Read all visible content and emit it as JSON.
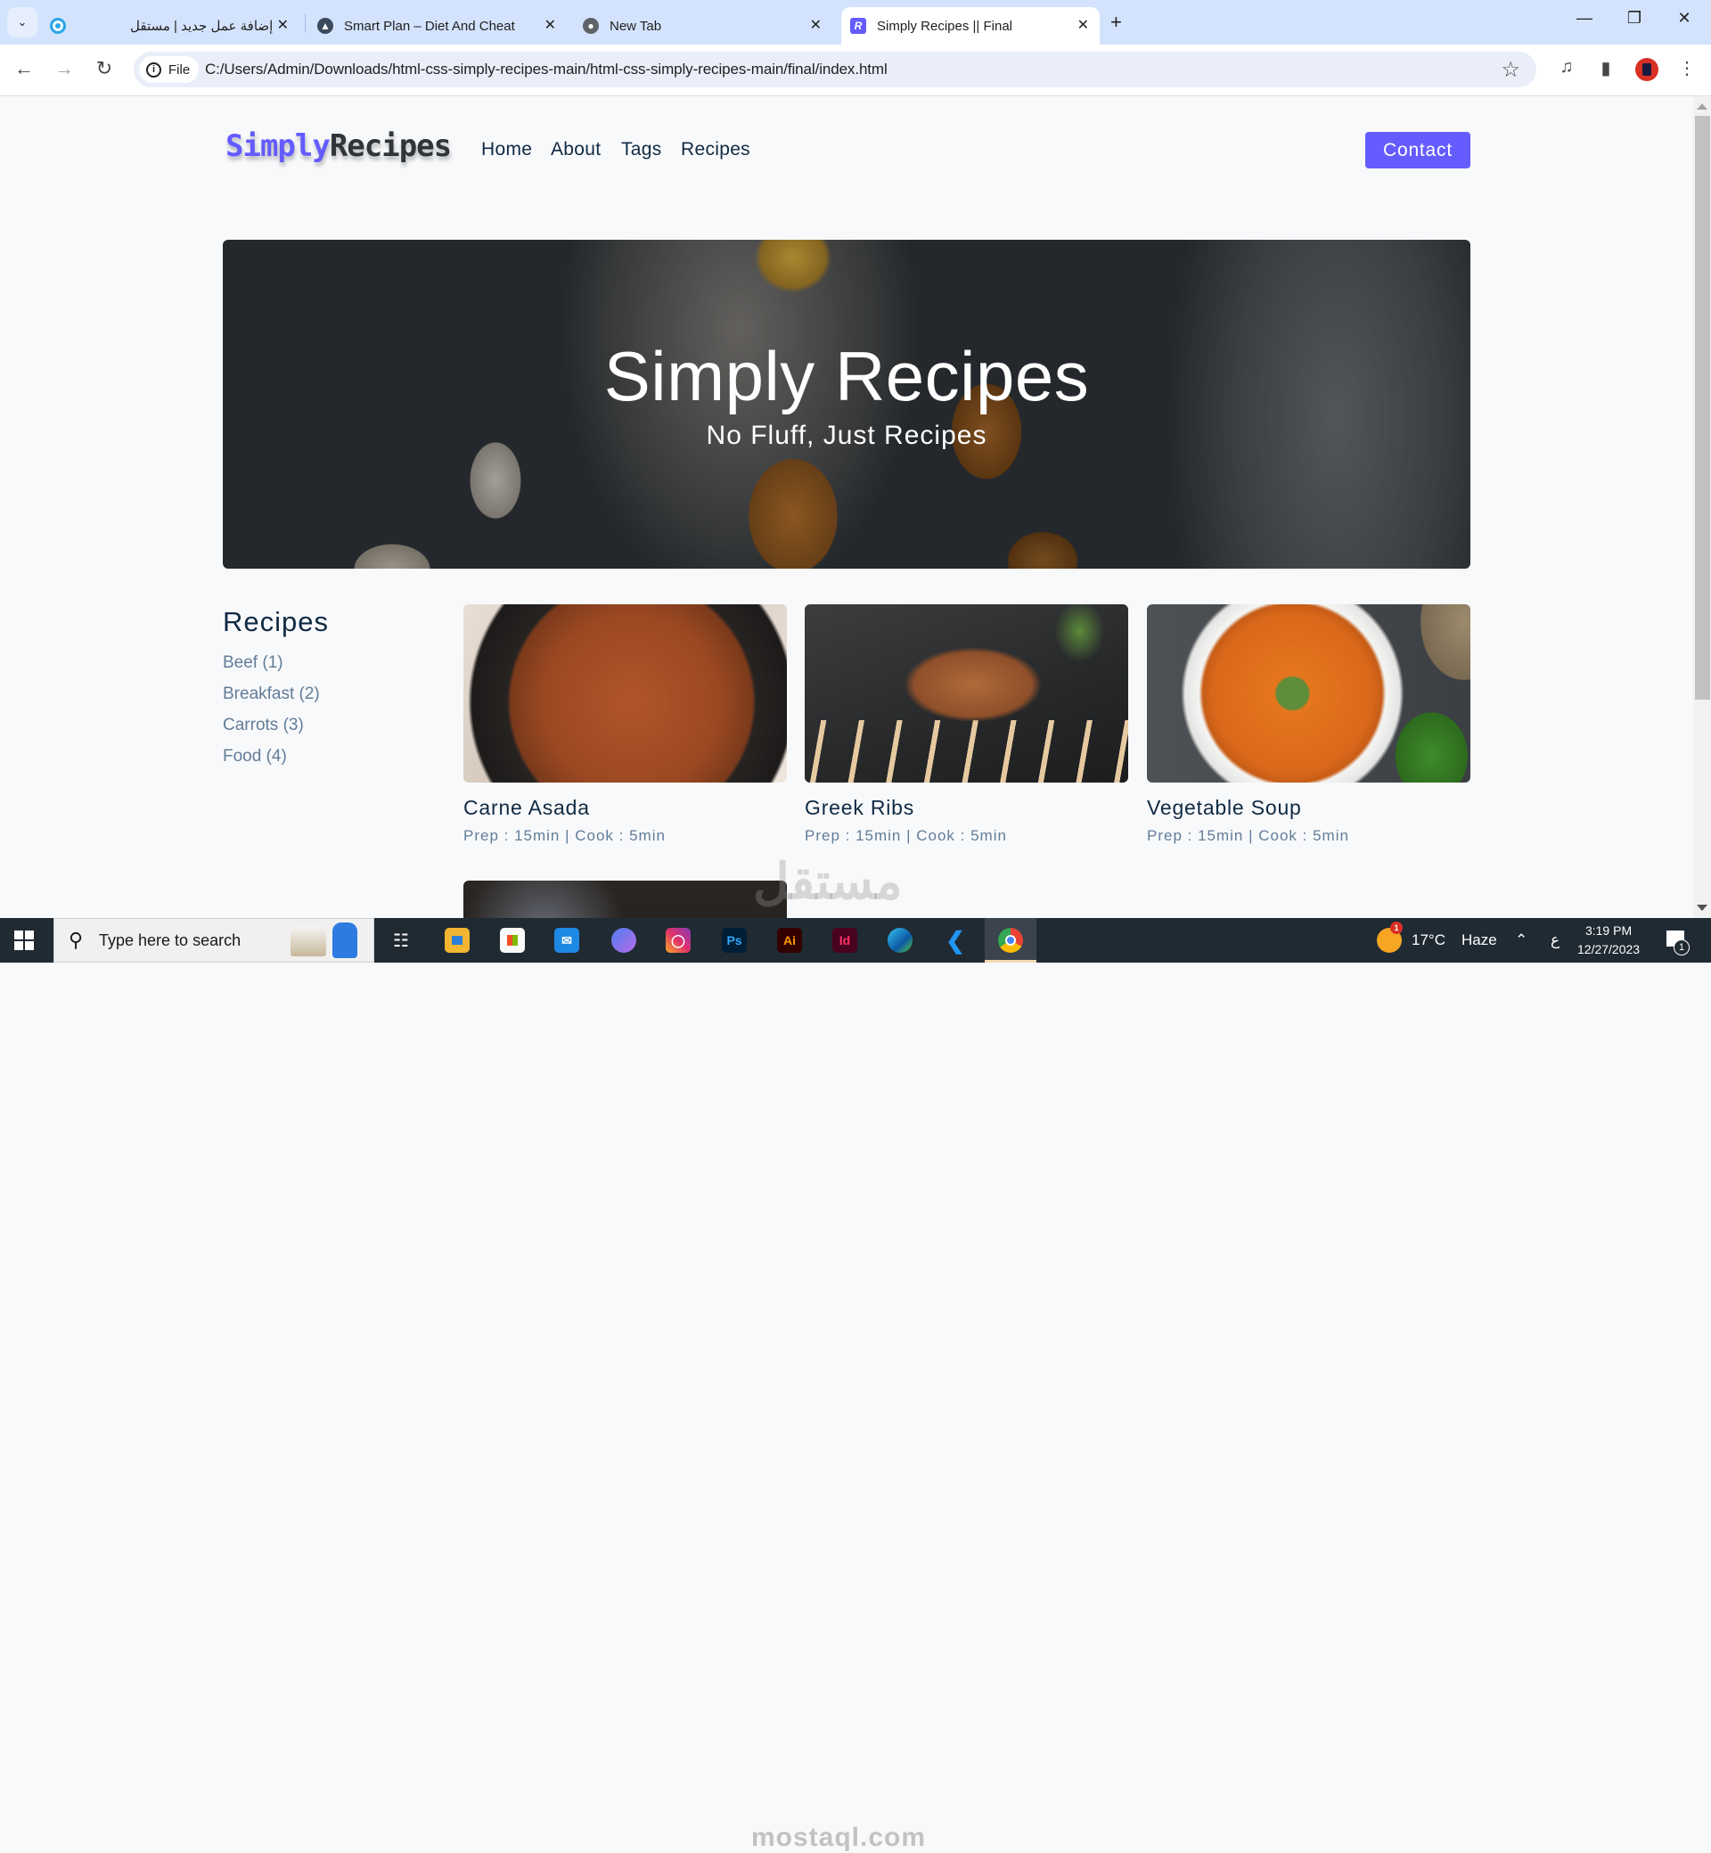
{
  "browser": {
    "tabs": [
      {
        "title": "إضافة عمل جديد | مستقل",
        "favicon": "mostaql-icon",
        "active": false
      },
      {
        "title": "Smart Plan – Diet And Cheat",
        "favicon": "smartplan-icon",
        "active": false
      },
      {
        "title": "New Tab",
        "favicon": "chrome-icon",
        "active": false
      },
      {
        "title": "Simply Recipes || Final",
        "favicon": "R",
        "active": true
      }
    ],
    "new_tab_symbol": "+",
    "address_chip": "File",
    "url": "C:/Users/Admin/Downloads/html-css-simply-recipes-main/html-css-simply-recipes-main/final/index.html"
  },
  "page": {
    "logo": {
      "part1": "Simply",
      "part2": "Recipes"
    },
    "nav": [
      {
        "label": "Home"
      },
      {
        "label": "About"
      },
      {
        "label": "Tags"
      },
      {
        "label": "Recipes"
      }
    ],
    "contact_label": "Contact",
    "hero": {
      "title": "Simply Recipes",
      "subtitle": "No Fluff, Just Recipes"
    },
    "sidebar": {
      "title": "Recipes",
      "tags": [
        {
          "label": "Beef (1)"
        },
        {
          "label": "Breakfast (2)"
        },
        {
          "label": "Carrots (3)"
        },
        {
          "label": "Food (4)"
        }
      ]
    },
    "recipes": [
      {
        "title": "Carne Asada",
        "meta": "Prep : 15min | Cook : 5min"
      },
      {
        "title": "Greek Ribs",
        "meta": "Prep : 15min | Cook : 5min"
      },
      {
        "title": "Vegetable Soup",
        "meta": "Prep : 15min | Cook : 5min"
      }
    ],
    "colors": {
      "primary": "#645cff",
      "heading": "#102a42",
      "muted": "#617d98"
    },
    "watermark": {
      "arabic": "مستقل",
      "latin": "mostaql.com"
    }
  },
  "taskbar": {
    "search_placeholder": "Type here to search",
    "apps": [
      "task-view",
      "file-explorer",
      "microsoft-store",
      "mail",
      "copilot",
      "instagram",
      "photoshop",
      "illustrator",
      "indesign",
      "edge",
      "vscode",
      "chrome"
    ],
    "app_labels": {
      "photoshop": "Ps",
      "illustrator": "Ai",
      "indesign": "Id"
    },
    "weather": {
      "temp": "17°C",
      "condition": "Haze",
      "badge": "1"
    },
    "language": "ع",
    "time": "3:19 PM",
    "date": "12/27/2023",
    "notification_count": "1"
  }
}
